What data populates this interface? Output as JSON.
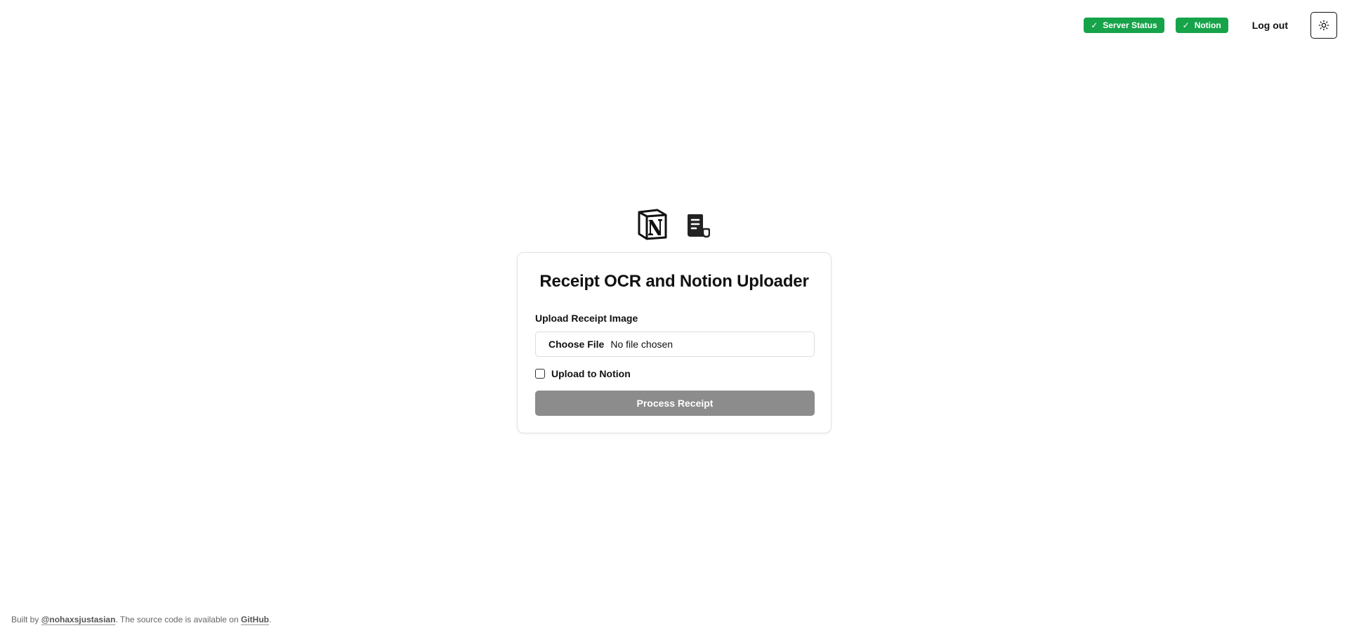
{
  "header": {
    "badges": [
      {
        "label": "Server Status",
        "icon": "check-icon",
        "color": "#16a34a"
      },
      {
        "label": "Notion",
        "icon": "check-icon",
        "color": "#16a34a"
      }
    ],
    "check_glyph": "✓",
    "logout_label": "Log out",
    "theme_icon": "sun-icon"
  },
  "logos": {
    "notion": "notion-logo-icon",
    "receipt": "receipt-icon"
  },
  "card": {
    "title": "Receipt OCR and Notion Uploader",
    "upload_label": "Upload Receipt Image",
    "file_button_label": "Choose File",
    "file_status": "No file chosen",
    "checkbox_label": "Upload to Notion",
    "checkbox_checked": false,
    "submit_label": "Process Receipt",
    "submit_color": "#8c8c8c"
  },
  "footer": {
    "prefix": "Built by ",
    "author": "@nohaxsjustasian",
    "middle": ". The source code is available on ",
    "link": "GitHub",
    "suffix": "."
  }
}
